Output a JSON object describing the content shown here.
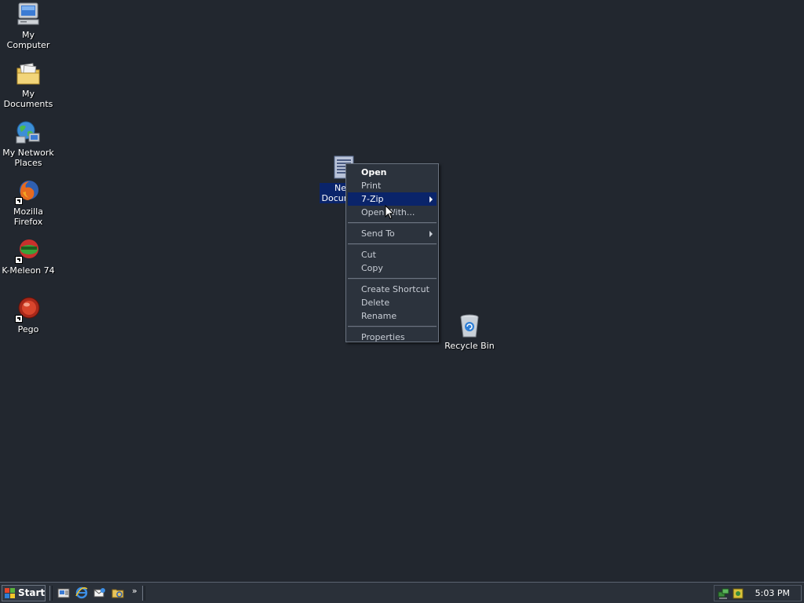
{
  "desktop": {
    "icons": [
      {
        "label": "My Computer"
      },
      {
        "label": "My Documents"
      },
      {
        "label": "My Network Places"
      },
      {
        "label": "Mozilla Firefox"
      },
      {
        "label": "K-Meleon 74"
      },
      {
        "label": "Pego"
      }
    ],
    "selected_icon_label": "New Document",
    "recycle_bin_label": "Recycle Bin"
  },
  "context_menu": {
    "items": [
      {
        "label": "Open"
      },
      {
        "label": "Print"
      },
      {
        "label": "7-Zip"
      },
      {
        "label": "Open With..."
      },
      {
        "label": "Send To"
      },
      {
        "label": "Cut"
      },
      {
        "label": "Copy"
      },
      {
        "label": "Create Shortcut"
      },
      {
        "label": "Delete"
      },
      {
        "label": "Rename"
      },
      {
        "label": "Properties"
      }
    ]
  },
  "taskbar": {
    "start_label": "Start",
    "overflow_label": "»",
    "clock": "5:03 PM"
  },
  "colors": {
    "desktop_bg": "#22272f",
    "selection": "#0a246a"
  }
}
